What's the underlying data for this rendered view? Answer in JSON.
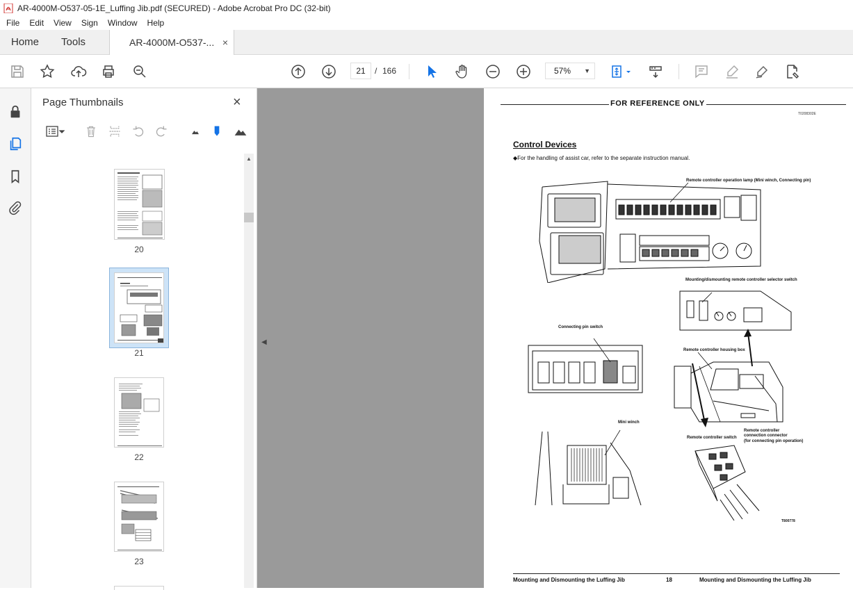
{
  "window": {
    "title": "AR-4000M-O537-05-1E_Luffing Jib.pdf (SECURED) - Adobe Acrobat Pro DC (32-bit)"
  },
  "menu": [
    "File",
    "Edit",
    "View",
    "Sign",
    "Window",
    "Help"
  ],
  "tabs": {
    "home": "Home",
    "tools": "Tools",
    "document": "AR-4000M-O537-...",
    "close": "×"
  },
  "toolbar": {
    "current_page": "21",
    "separator": "/",
    "total_pages": "166",
    "zoom": "57%"
  },
  "thumbnails_panel": {
    "title": "Page Thumbnails",
    "close": "×",
    "pages": [
      {
        "label": "20",
        "selected": false
      },
      {
        "label": "21",
        "selected": true
      },
      {
        "label": "22",
        "selected": false
      },
      {
        "label": "23",
        "selected": false
      }
    ]
  },
  "page": {
    "reference_title": "FOR  REFERENCE ONLY",
    "code_top": "T0208302E",
    "section_title": "Control Devices",
    "note": "◆For the handling of assist car, refer to the separate instruction manual.",
    "captions": {
      "remote_lamp": "Remote controller operation lamp (Mini winch, Connecting pin)",
      "selector_switch": "Mounting/dismounting remote controller selector switch",
      "connecting_pin_switch": "Connecting pin switch",
      "housing_box": "Remote controller housing box",
      "mini_winch": "Mini winch",
      "remote_switch": "Remote controller switch",
      "connection_connector_1": "Remote controller",
      "connection_connector_2": "connection connector",
      "connection_connector_3": "(for connecting pin operation)",
      "figure_code": "T800778"
    },
    "footer": {
      "left": "Mounting and Dismounting the Luffing Jib",
      "page_number": "18",
      "right": "Mounting and Dismounting the Luffing Jib"
    }
  },
  "colors": {
    "accent_blue": "#1473e6",
    "pdf_red": "#d0312d",
    "doc_background": "#9a9a9a"
  }
}
